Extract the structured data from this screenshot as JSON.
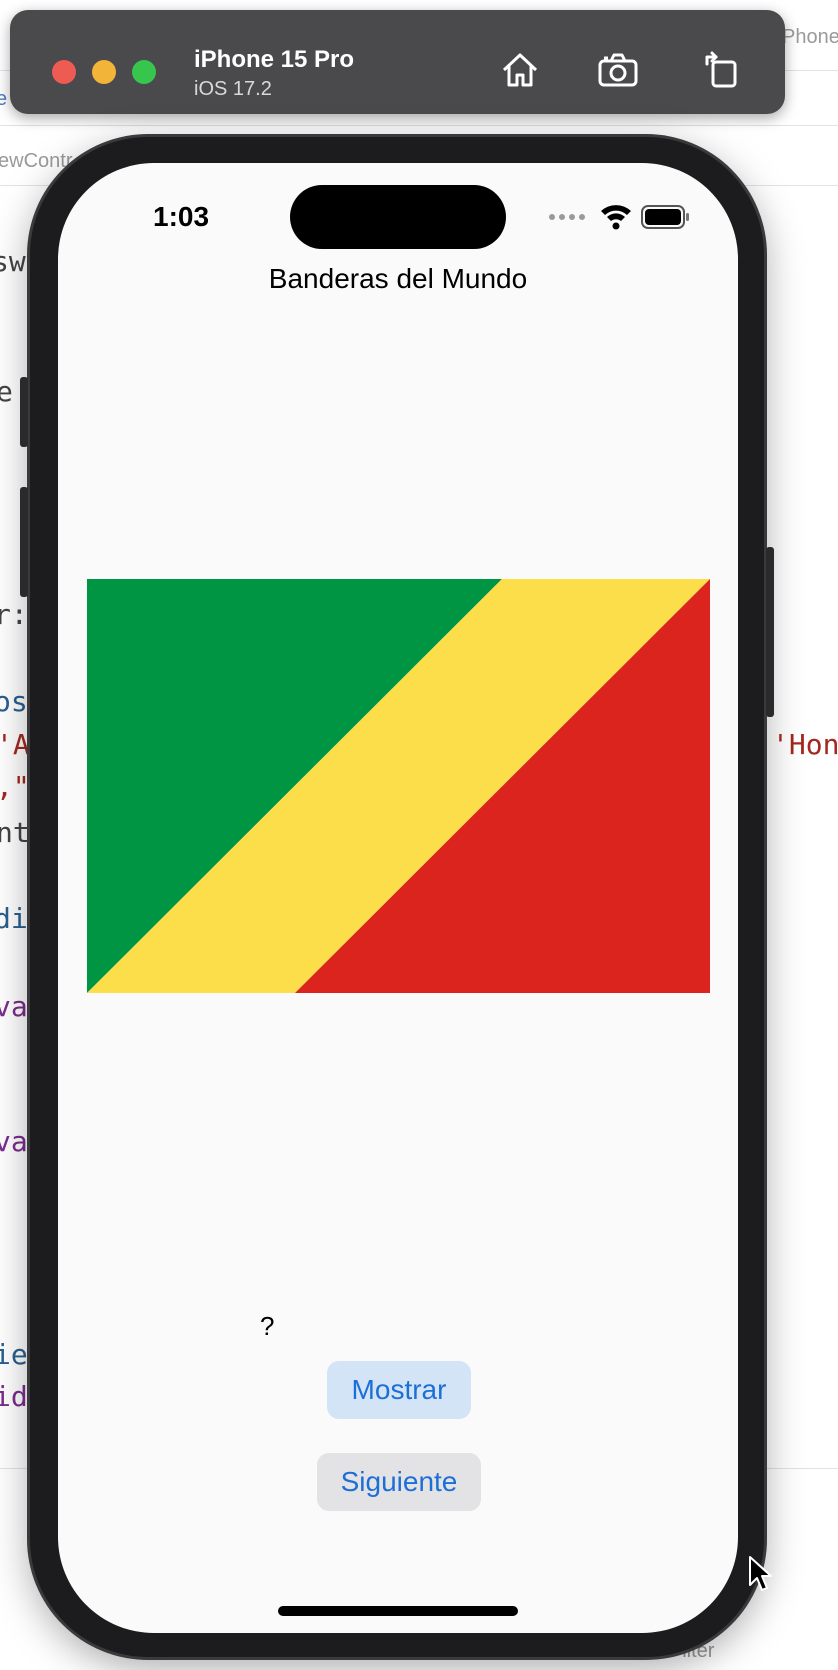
{
  "simulator": {
    "device_name": "iPhone 15 Pro",
    "os_version": "iOS 17.2",
    "toolbar_icons": [
      "home-icon",
      "screenshot-icon",
      "rotate-icon"
    ]
  },
  "status_bar": {
    "time": "1:03",
    "icons": [
      "cellular-icon",
      "wifi-icon",
      "battery-icon"
    ]
  },
  "app": {
    "title": "Banderas del Mundo",
    "answer_text": "?",
    "show_button_label": "Mostrar",
    "next_button_label": "Siguiente",
    "flag": {
      "colors": {
        "green": "#009543",
        "yellow": "#FBDE4A",
        "red": "#DC241F"
      }
    }
  },
  "background_editor": {
    "top_right_label": "Phone",
    "left_fragments": [
      "e",
      "ewContr",
      "sw",
      "e",
      "r:",
      "os",
      "'A",
      ",\"",
      "nt",
      "di",
      "va",
      "va",
      "ie",
      "id"
    ],
    "right_fragments": [
      "'Hon"
    ],
    "filter_label": "Filter"
  },
  "colors": {
    "accent": "#1c6fd6",
    "toolbar_bg": "#4a4a4c",
    "screen_bg": "#fafafa"
  }
}
